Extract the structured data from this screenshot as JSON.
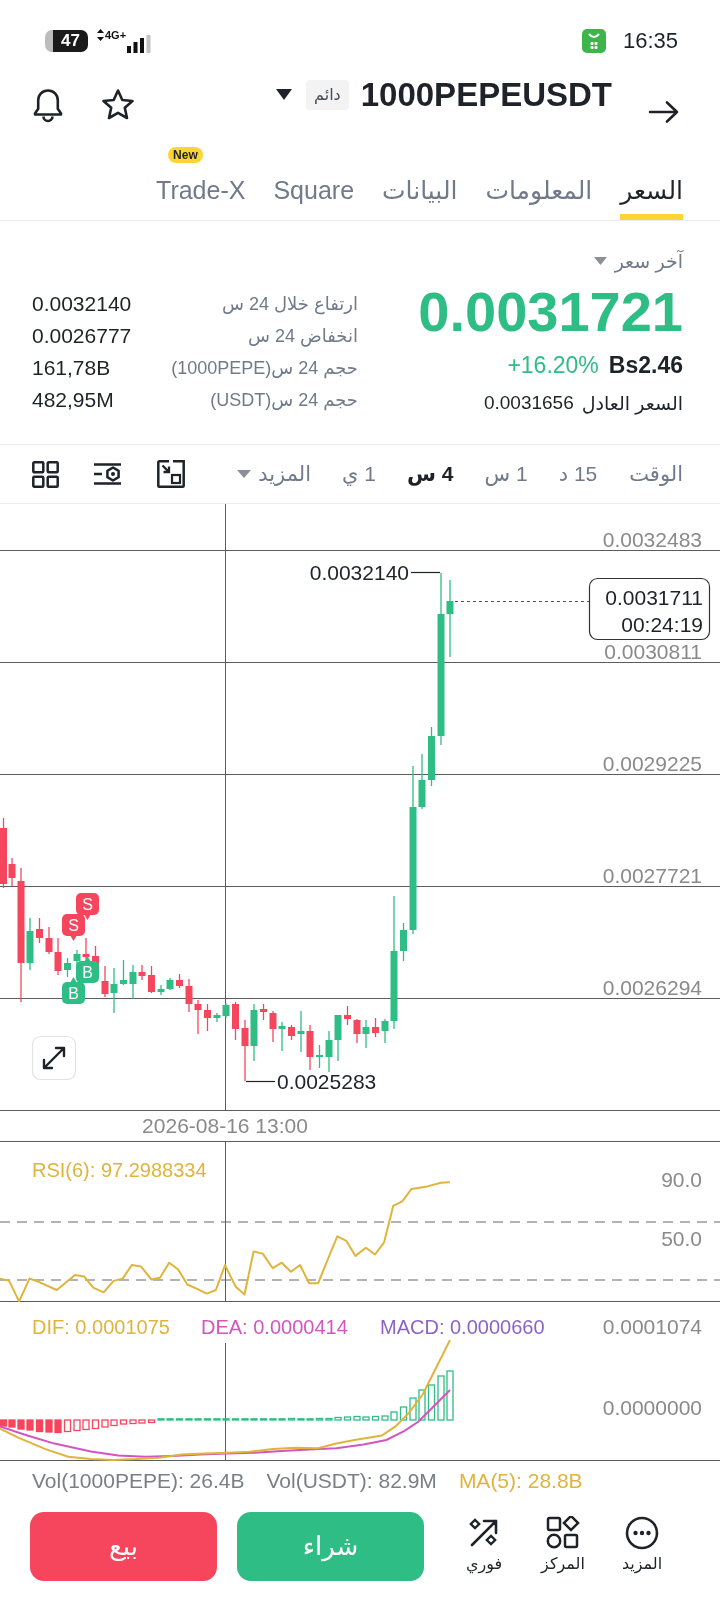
{
  "status_bar": {
    "battery": "47",
    "network": "4G+",
    "time": "16:35"
  },
  "header": {
    "symbol": "1000PEPEUSDT",
    "badge": "دائم"
  },
  "tabs": [
    {
      "label": "السعر",
      "selected": true
    },
    {
      "label": "المعلومات",
      "selected": false
    },
    {
      "label": "البيانات",
      "selected": false
    },
    {
      "label": "Square",
      "selected": false
    },
    {
      "label": "Trade-X",
      "selected": false,
      "badge": "New"
    }
  ],
  "price": {
    "last_price_label": "آخر سعر",
    "last_price": "0.0031721",
    "rising": true,
    "change_percent": "+16.20%",
    "change_value": "Bs2.46",
    "mark_price_label": "السعر العادل",
    "mark_price": "0.0031656"
  },
  "stats": [
    {
      "label": "ارتفاع خلال 24 س",
      "value": "0.0032140"
    },
    {
      "label": "انخفاض 24 س",
      "value": "0.0026777"
    },
    {
      "label": "حجم 24 س(1000PEPE)",
      "value": "161,78B"
    },
    {
      "label": "حجم 24 س(USDT)",
      "value": "482,95M"
    }
  ],
  "intervals": {
    "label": "الوقت",
    "options": [
      {
        "label": "15 د",
        "selected": false
      },
      {
        "label": "1 س",
        "selected": false
      },
      {
        "label": "4 س",
        "selected": true
      },
      {
        "label": "1 ي",
        "selected": false
      }
    ],
    "more": "المزيد"
  },
  "chart": {
    "price_ticks": [
      "0.0032483",
      "0.0030811",
      "0.0029225",
      "0.0027721",
      "0.0026294"
    ],
    "high_label": "0.0032140",
    "low_label": "0.0025283",
    "last_price": "0.0031711",
    "countdown": "00:24:19",
    "time_label": "2026-08-16 13:00",
    "markers": [
      {
        "kind": "sell",
        "text": "S"
      },
      {
        "kind": "sell",
        "text": "S"
      },
      {
        "kind": "buy",
        "text": "B"
      },
      {
        "kind": "buy",
        "text": "B"
      }
    ]
  },
  "rsi": {
    "label": "RSI(6): 97.2988334",
    "ticks": [
      "90.0",
      "50.0"
    ]
  },
  "macd": {
    "labels": [
      {
        "kind": "macd",
        "text": "MACD: 0.0000660",
        "color": "#8e63c8"
      },
      {
        "kind": "dea",
        "text": "DEA: 0.0000414",
        "color": "#d355c0"
      },
      {
        "kind": "dif",
        "text": "DIF: 0.0001075",
        "color": "#e0b43c"
      }
    ],
    "ticks": [
      "0.0001074",
      "0.0000000"
    ]
  },
  "volume": [
    {
      "text": "MA(5): 28.8B",
      "color": "#e0b43c"
    },
    {
      "text": "Vol(USDT): 82.9M",
      "color": "#7a7f87"
    },
    {
      "text": "Vol(1000PEPE): 26.4B",
      "color": "#7a7f87"
    }
  ],
  "actions": {
    "nav": [
      {
        "kind": "more",
        "label": "المزيد"
      },
      {
        "kind": "center",
        "label": "المركز"
      },
      {
        "kind": "instant",
        "label": "فوري"
      }
    ],
    "trade_buttons": [
      {
        "kind": "buy",
        "label": "شراء"
      },
      {
        "kind": "sell",
        "label": "بيع"
      }
    ]
  }
}
